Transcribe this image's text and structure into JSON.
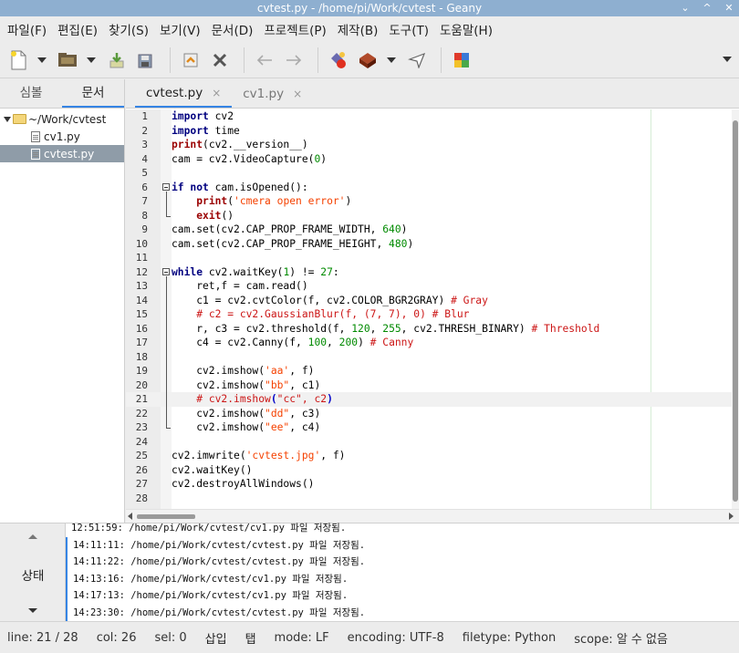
{
  "window": {
    "title": "cvtest.py - /home/pi/Work/cvtest - Geany",
    "controls": [
      "⌄",
      "^",
      "✕"
    ]
  },
  "menu": [
    "파일(F)",
    "편집(E)",
    "찾기(S)",
    "보기(V)",
    "문서(D)",
    "프로젝트(P)",
    "제작(B)",
    "도구(T)",
    "도움말(H)"
  ],
  "toolbar": {
    "icons": [
      "new-file-icon",
      "open-file-icon",
      "save-icon",
      "save-all-icon",
      "revert-icon",
      "close-file-icon",
      "back-icon",
      "forward-icon",
      "compile-icon",
      "build-icon",
      "execute-icon",
      "color-chooser-icon"
    ]
  },
  "sidebar": {
    "tabs": [
      "심볼",
      "문서"
    ],
    "active_tab": 1,
    "tree": {
      "folder": "~/Work/cvtest",
      "files": [
        "cv1.py",
        "cvtest.py"
      ],
      "selected": 1
    }
  },
  "editor": {
    "tabs": [
      {
        "label": "cvtest.py",
        "active": true,
        "close": "×"
      },
      {
        "label": "cv1.py",
        "active": false,
        "close": "×"
      }
    ],
    "current_line": 21,
    "lines": [
      "import cv2",
      "import time",
      "print(cv2.__version__)",
      "cam = cv2.VideoCapture(0)",
      "",
      "if not cam.isOpened():",
      "    print('cmera open error')",
      "    exit()",
      "cam.set(cv2.CAP_PROP_FRAME_WIDTH, 640)",
      "cam.set(cv2.CAP_PROP_FRAME_HEIGHT, 480)",
      "",
      "while cv2.waitKey(1) != 27:",
      "    ret,f = cam.read()",
      "    c1 = cv2.cvtColor(f, cv2.COLOR_BGR2GRAY) # Gray",
      "    # c2 = cv2.GaussianBlur(f, (7, 7), 0) # Blur",
      "    r, c3 = cv2.threshold(f, 120, 255, cv2.THRESH_BINARY) # Threshold",
      "    c4 = cv2.Canny(f, 100, 200) # Canny",
      "",
      "    cv2.imshow('aa', f)",
      "    cv2.imshow(\"bb\", c1)",
      "    # cv2.imshow(\"cc\", c2)",
      "    cv2.imshow(\"dd\", c3)",
      "    cv2.imshow(\"ee\", c4)",
      "",
      "cv2.imwrite('cvtest.jpg', f)",
      "cv2.waitKey()",
      "cv2.destroyAllWindows()",
      ""
    ]
  },
  "messages": {
    "label": "상태",
    "lines": [
      "12:51:59: /home/pi/Work/cvtest/cv1.py 파일 저장됨.",
      "14:11:11: /home/pi/Work/cvtest/cvtest.py 파일 저장됨.",
      "14:11:22: /home/pi/Work/cvtest/cvtest.py 파일 저장됨.",
      "14:13:16: /home/pi/Work/cvtest/cv1.py 파일 저장됨.",
      "14:17:13: /home/pi/Work/cvtest/cv1.py 파일 저장됨.",
      "14:23:30: /home/pi/Work/cvtest/cvtest.py 파일 저장됨."
    ]
  },
  "status": {
    "line": "line: 21 / 28",
    "col": "col: 26",
    "sel": "sel: 0",
    "insert": "삽입",
    "tab": "탭",
    "mode": "mode: LF",
    "encoding": "encoding: UTF-8",
    "filetype": "filetype: Python",
    "scope": "scope: 알 수 없음"
  }
}
